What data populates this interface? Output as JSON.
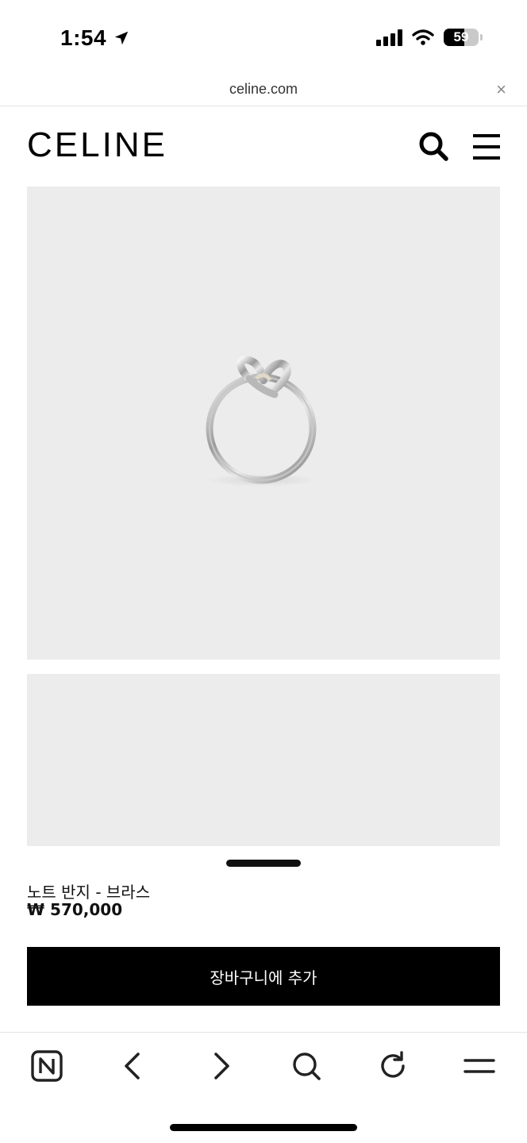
{
  "status_bar": {
    "time": "1:54",
    "battery": "59",
    "battery_level": 0.59,
    "icons": [
      "location-arrow-icon",
      "signal-icon",
      "wifi-icon",
      "battery-icon"
    ]
  },
  "browser": {
    "url": "celine.com",
    "close_label": "×"
  },
  "header": {
    "logo": "CELINE",
    "icons": [
      "search-icon",
      "hamburger-menu-icon"
    ]
  },
  "product": {
    "name": "노트 반지 - 브라스",
    "price": "₩ 570,000",
    "add_to_cart_label": "장바구니에 추가",
    "image_subject": "ring-image"
  },
  "toolbar": {
    "icons": [
      "naver-home-icon",
      "back-icon",
      "forward-icon",
      "search-icon",
      "refresh-icon",
      "menu-icon"
    ]
  },
  "colors": {
    "image_bg": "#ececec",
    "button_bg": "#000000",
    "button_text": "#ffffff"
  }
}
